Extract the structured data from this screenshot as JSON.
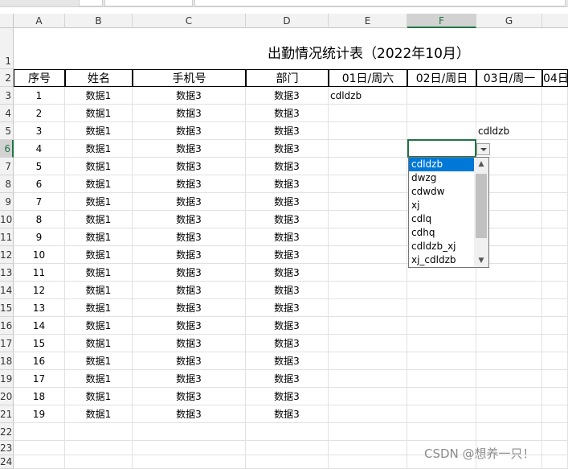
{
  "columns": [
    "A",
    "B",
    "C",
    "D",
    "E",
    "F",
    "G"
  ],
  "partial_column": "04日",
  "title": "出勤情况统计表（2022年10月）",
  "headers": [
    "序号",
    "姓名",
    "手机号",
    "部门",
    "01日/周六",
    "02日/周日",
    "03日/周一"
  ],
  "row_numbers": [
    "1",
    "2",
    "3",
    "4",
    "5",
    "6",
    "7",
    "8",
    "9",
    "10",
    "11",
    "12",
    "13",
    "14",
    "15",
    "16",
    "17",
    "18",
    "19",
    "20",
    "21",
    "22",
    "23",
    "24"
  ],
  "data_rows": [
    {
      "seq": "1",
      "name": "数据1",
      "phone": "数据3",
      "dept": "数据3"
    },
    {
      "seq": "2",
      "name": "数据1",
      "phone": "数据3",
      "dept": "数据3"
    },
    {
      "seq": "3",
      "name": "数据1",
      "phone": "数据3",
      "dept": "数据3"
    },
    {
      "seq": "4",
      "name": "数据1",
      "phone": "数据3",
      "dept": "数据3"
    },
    {
      "seq": "5",
      "name": "数据1",
      "phone": "数据3",
      "dept": "数据3"
    },
    {
      "seq": "6",
      "name": "数据1",
      "phone": "数据3",
      "dept": "数据3"
    },
    {
      "seq": "7",
      "name": "数据1",
      "phone": "数据3",
      "dept": "数据3"
    },
    {
      "seq": "8",
      "name": "数据1",
      "phone": "数据3",
      "dept": "数据3"
    },
    {
      "seq": "9",
      "name": "数据1",
      "phone": "数据3",
      "dept": "数据3"
    },
    {
      "seq": "10",
      "name": "数据1",
      "phone": "数据3",
      "dept": "数据3"
    },
    {
      "seq": "11",
      "name": "数据1",
      "phone": "数据3",
      "dept": "数据3"
    },
    {
      "seq": "12",
      "name": "数据1",
      "phone": "数据3",
      "dept": "数据3"
    },
    {
      "seq": "13",
      "name": "数据1",
      "phone": "数据3",
      "dept": "数据3"
    },
    {
      "seq": "14",
      "name": "数据1",
      "phone": "数据3",
      "dept": "数据3"
    },
    {
      "seq": "15",
      "name": "数据1",
      "phone": "数据3",
      "dept": "数据3"
    },
    {
      "seq": "16",
      "name": "数据1",
      "phone": "数据3",
      "dept": "数据3"
    },
    {
      "seq": "17",
      "name": "数据1",
      "phone": "数据3",
      "dept": "数据3"
    },
    {
      "seq": "18",
      "name": "数据1",
      "phone": "数据3",
      "dept": "数据3"
    },
    {
      "seq": "19",
      "name": "数据1",
      "phone": "数据3",
      "dept": "数据3"
    }
  ],
  "cell_values": {
    "E3": "cdldzb",
    "G5": "cdldzb"
  },
  "dropdown_options": [
    "cdldzb",
    "dwzg",
    "cdwdw",
    "xj",
    "cdlq",
    "cdhq",
    "cdldzb_xj",
    "xj_cdldzb"
  ],
  "dropdown_selected_index": 0,
  "active_cell": "F6",
  "watermark": "CSDN @想养一只！",
  "colors": {
    "accent": "#217346",
    "highlight": "#0078d7"
  }
}
